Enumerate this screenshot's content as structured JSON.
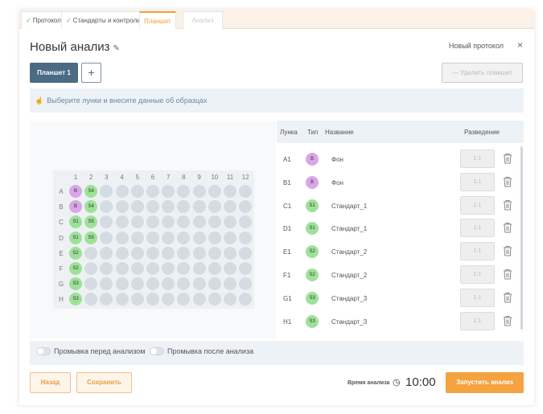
{
  "tabs": [
    {
      "label": "Протокол",
      "done": true
    },
    {
      "label": "Стандарты и контроли",
      "done": true
    },
    {
      "label": "Планшет",
      "done": false
    },
    {
      "label": "Анализ",
      "done": false
    }
  ],
  "header": {
    "title": "Новый анализ",
    "protocol": "Новый протокол",
    "close": "×"
  },
  "toolbar": {
    "plate_label": "Планшет 1",
    "add_label": "+",
    "delete_label": "— Удалить планшет"
  },
  "hint": "Выберите лунки и внесите данные об образцах",
  "plate": {
    "columns": [
      "1",
      "2",
      "3",
      "4",
      "5",
      "6",
      "7",
      "8",
      "9",
      "10",
      "11",
      "12"
    ],
    "rows": [
      "A",
      "B",
      "C",
      "D",
      "E",
      "F",
      "G",
      "H"
    ],
    "filled": {
      "A1": "B",
      "A2": "S4",
      "B1": "B",
      "B2": "S4",
      "C1": "S1",
      "C2": "S5",
      "D1": "S1",
      "D2": "S5",
      "E1": "S2",
      "F1": "S2",
      "G1": "S3",
      "H1": "S3"
    }
  },
  "table": {
    "headers": {
      "well": "Лунка",
      "type": "Тип",
      "name": "Название",
      "dilution": "Разведение"
    },
    "rows": [
      {
        "well": "A1",
        "type": "B",
        "name": "Фон",
        "dilution": "1:1"
      },
      {
        "well": "B1",
        "type": "B",
        "name": "Фон",
        "dilution": "1:1"
      },
      {
        "well": "C1",
        "type": "S1",
        "name": "Стандарт_1",
        "dilution": "1:1"
      },
      {
        "well": "D1",
        "type": "S1",
        "name": "Стандарт_1",
        "dilution": "1:1"
      },
      {
        "well": "E1",
        "type": "S2",
        "name": "Стандарт_2",
        "dilution": "1:1"
      },
      {
        "well": "F1",
        "type": "S2",
        "name": "Стандарт_2",
        "dilution": "1:1"
      },
      {
        "well": "G1",
        "type": "S3",
        "name": "Стандарт_3",
        "dilution": "1:1"
      },
      {
        "well": "H1",
        "type": "S3",
        "name": "Стандарт_3",
        "dilution": "1:1"
      }
    ]
  },
  "toggles": {
    "wash_before": "Промывка перед анализом",
    "wash_after": "Промывка после анализа"
  },
  "footer": {
    "back_label": "Назад",
    "save_label": "Сохранить",
    "time_label": "Время анализа",
    "time_value": "10:00",
    "run_label": "Запустить анализ"
  },
  "colors": {
    "accent": "#f4a340",
    "blank": "#d9a6e8",
    "standard": "#9ee29a",
    "primary": "#4b6b85"
  }
}
